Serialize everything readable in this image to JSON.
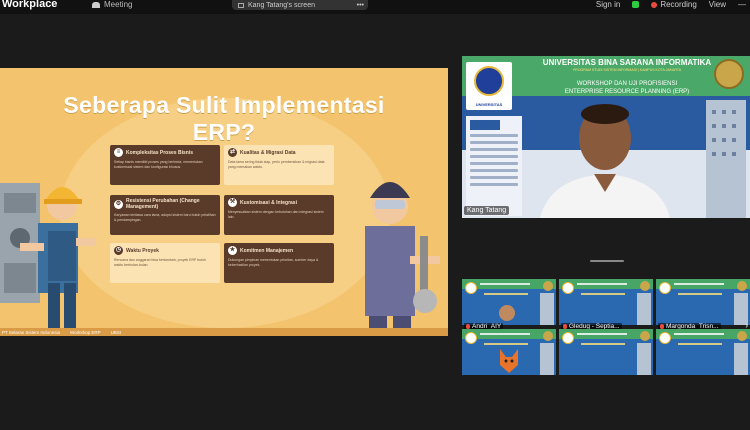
{
  "topbar": {
    "app_name": "Workplace",
    "meeting_label": "Meeting",
    "screen_share_label": "Kang Tatang's screen",
    "sign_in": "Sign in",
    "recording_label": "Recording",
    "view_label": "View"
  },
  "slide": {
    "title_line1": "Seberapa Sulit Implementasi",
    "title_line2": "ERP?",
    "cards": [
      {
        "title": "Kompleksitas Proses Bisnis",
        "desc": "Setiap bisnis memiliki proses yang berbeda, memerlukan kustomisasi sistem dan konfigurasi khusus.",
        "icon": "≡"
      },
      {
        "title": "Kualitas & Migrasi Data",
        "desc": "Data lama sering tidak siap, perlu pembersihan & migrasi data yang memakan waktu.",
        "icon": "⇄"
      },
      {
        "title": "Resistensi Perubahan (Change Management)",
        "desc": "Karyawan terbiasa cara lama, adopsi sistem baru butuh pelatihan & pendampingan.",
        "icon": "⚙"
      },
      {
        "title": "Kustomisasi & Integrasi",
        "desc": "Menyesuaikan sistem dengan kebutuhan dan integrasi sistem lain.",
        "icon": "⚒"
      },
      {
        "title": "Waktu Proyek",
        "desc": "Rencana dan anggaran bisa bertambah, proyek ERP butuh waktu berbulan-bulan.",
        "icon": "◷"
      },
      {
        "title": "Komitmen Manajemen",
        "desc": "Dukungan pimpinan menentukan prioritas, sumber daya & keberhasilan proyek.",
        "icon": "★"
      }
    ],
    "footer_items": [
      "PT Selaras Sistem Indonesia",
      "Workshop ERP",
      "UBSI"
    ]
  },
  "speaker": {
    "university": "UNIVERSITAS BINA SARANA INFORMATIKA",
    "sub": "PROGRAM STUDI SISTEM INFORMASI | KAMPUS KOTA JAKARTA",
    "workshop_line1": "WORKSHOP DAN UJI PROFISIENSI",
    "workshop_line2": "ENTERPRISE RESOURCE PLANNING (ERP)",
    "logo_label": "UNIVERSITAS",
    "name": "Kang Tatang"
  },
  "gallery": {
    "tiles": [
      {
        "name": "",
        "muted": false
      },
      {
        "name": "",
        "muted": false
      },
      {
        "name": "",
        "muted": false
      },
      {
        "name": "Andri_AIY",
        "muted": true
      },
      {
        "name": "Gledug - Septia...",
        "muted": true
      },
      {
        "name": "Margonda_Trisn...",
        "muted": true
      },
      {
        "name": "",
        "muted": false
      },
      {
        "name": "",
        "muted": false
      },
      {
        "name": "",
        "muted": false
      }
    ]
  },
  "colors": {
    "slide_bg": "#f3c46d",
    "card_dark": "#5a3b2a",
    "card_light": "#fbe3b4",
    "banner_green": "#4aa868",
    "banner_blue": "#2a5aa0"
  }
}
